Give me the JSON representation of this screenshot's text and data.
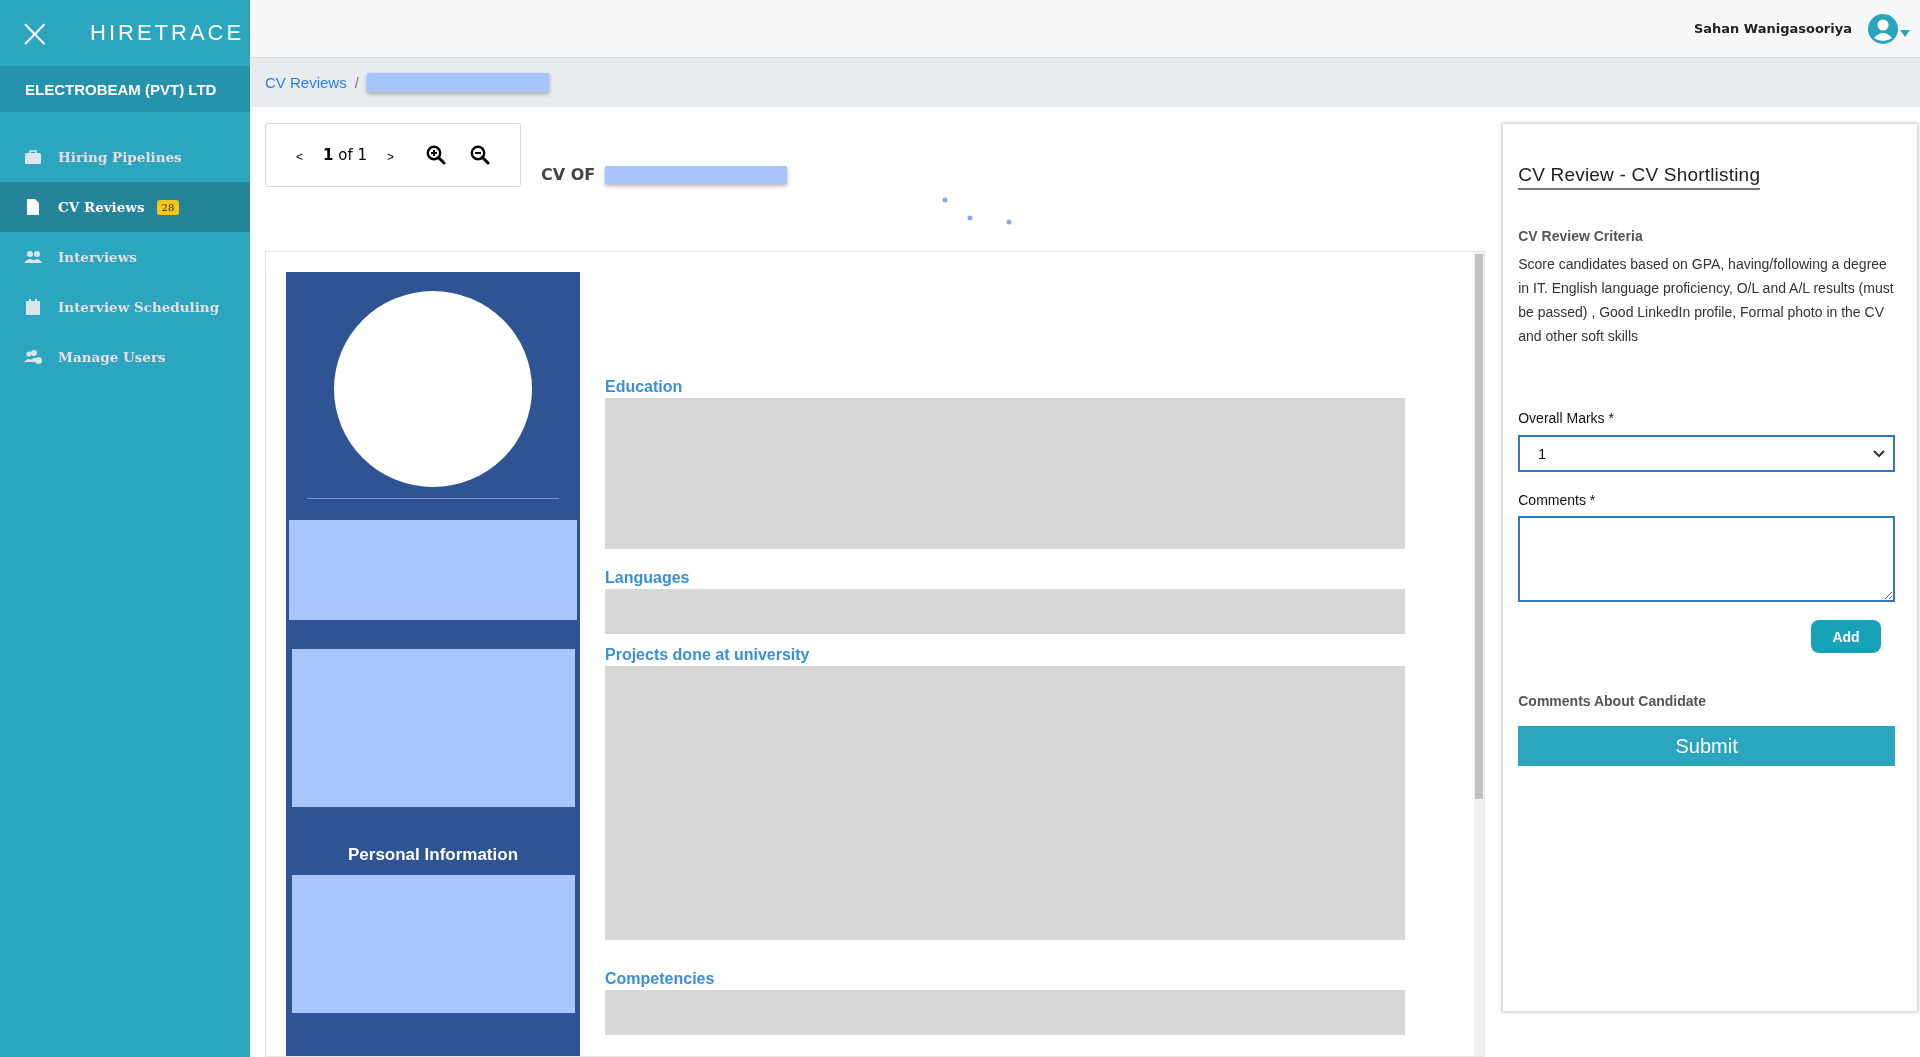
{
  "app": {
    "logo": "HIRETRACE",
    "close_icon": "×",
    "company": "ELECTROBEAM (PVT) LTD"
  },
  "sidebar": {
    "items": [
      {
        "label": "Hiring Pipelines",
        "kind": "briefcase",
        "selected": false
      },
      {
        "label": "CV Reviews",
        "kind": "file",
        "selected": true,
        "badge": "28"
      },
      {
        "label": "Interviews",
        "kind": "users",
        "selected": false
      },
      {
        "label": "Interview Scheduling",
        "kind": "calendar",
        "selected": false
      },
      {
        "label": "Manage Users",
        "kind": "users-cog",
        "selected": false
      }
    ]
  },
  "header": {
    "user_name": "Sahan Wanigasooriya"
  },
  "breadcrumb": {
    "items": [
      "CV Reviews"
    ],
    "separator": "/"
  },
  "viewer": {
    "prev": "<",
    "page": "**1** of 1",
    "next": ">",
    "cv_of_label": "CV OF",
    "profile_heading": "Personal Information",
    "sections": [
      {
        "title": "Education",
        "kind": "tall"
      },
      {
        "title": "Languages",
        "kind": "short"
      },
      {
        "title": "Projects done at university",
        "kind": "huge"
      },
      {
        "title": "Competencies",
        "kind": "short"
      }
    ]
  },
  "review_panel": {
    "title": "CV Review -  CV Shortlisting",
    "criteria_label": "CV Review Criteria",
    "criteria": "Score candidates based on GPA, having/following a degree in IT. English language proficiency, O/L and A/L results (must be passed) , Good LinkedIn profile, Formal photo in the CV and other soft skills",
    "marks_label": "Overall Marks *",
    "marks_value": "1",
    "comments_label": "Comments *",
    "add_button": "Add",
    "comments_about_label": "Comments About Candidate",
    "submit_button": "Submit"
  }
}
